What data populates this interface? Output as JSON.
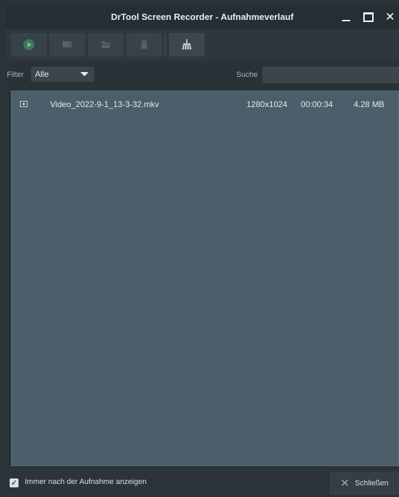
{
  "window": {
    "title": "DrTool Screen Recorder - Aufnahmeverlauf",
    "minimize_icon": "minimize-icon",
    "maximize_icon": "maximize-icon",
    "close_glyph": "✕"
  },
  "toolbar": {
    "buttons": [
      {
        "icon": "play-icon"
      },
      {
        "icon": "edit-icon"
      },
      {
        "icon": "folder-icon"
      },
      {
        "icon": "trash-icon"
      },
      {
        "icon": "broom-icon"
      }
    ]
  },
  "filter": {
    "label": "Filter",
    "selected": "Alle"
  },
  "search": {
    "label": "Suche",
    "value": ""
  },
  "recordings": [
    {
      "name": "Video_2022-9-1_13-3-32.mkv",
      "resolution": "1280x1024",
      "duration": "00:00:34",
      "size": "4.28 MB"
    }
  ],
  "footer": {
    "checkbox_checked": true,
    "checkbox_label": "Immer nach der Aufnahme anzeigen",
    "close_label": "Schließen",
    "close_glyph": "✕"
  },
  "colors": {
    "background": "#2a3137",
    "list_background": "#4a5f6a",
    "accent_play": "#3f7a56"
  }
}
